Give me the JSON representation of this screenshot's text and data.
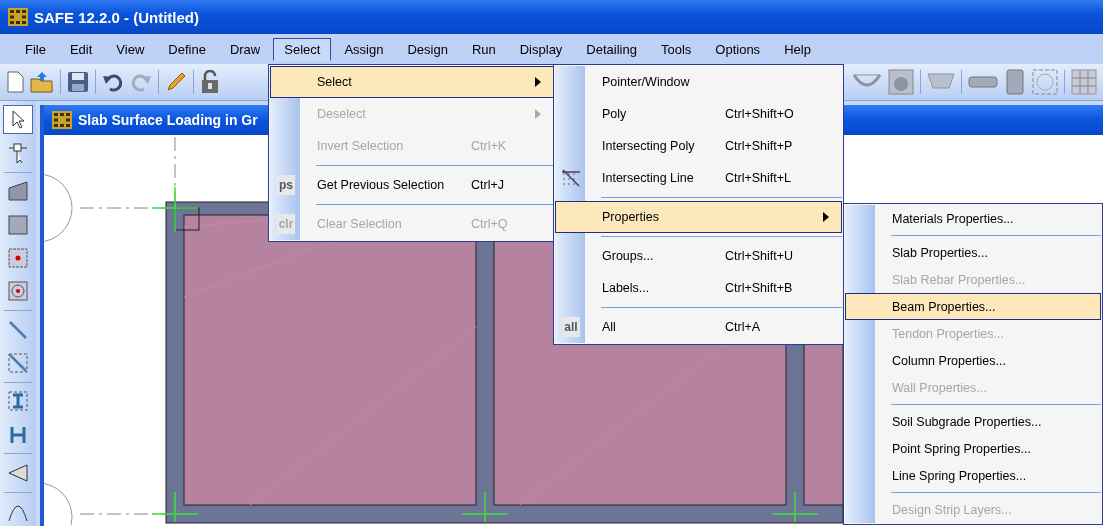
{
  "window": {
    "title": "SAFE 12.2.0 - (Untitled)"
  },
  "menu_bar": [
    {
      "label": "File",
      "selected": false
    },
    {
      "label": "Edit",
      "selected": false
    },
    {
      "label": "View",
      "selected": false
    },
    {
      "label": "Define",
      "selected": false
    },
    {
      "label": "Draw",
      "selected": false
    },
    {
      "label": "Select",
      "selected": true
    },
    {
      "label": "Assign",
      "selected": false
    },
    {
      "label": "Design",
      "selected": false
    },
    {
      "label": "Run",
      "selected": false
    },
    {
      "label": "Display",
      "selected": false
    },
    {
      "label": "Detailing",
      "selected": false
    },
    {
      "label": "Tools",
      "selected": false
    },
    {
      "label": "Options",
      "selected": false
    },
    {
      "label": "Help",
      "selected": false
    }
  ],
  "left_toolbar": [
    {
      "kind": "pointer",
      "selected": true
    },
    {
      "kind": "reshape",
      "selected": false
    },
    {
      "kind": "separator"
    },
    {
      "kind": "slab-poly",
      "selected": false
    },
    {
      "kind": "slab-rect",
      "selected": false
    },
    {
      "kind": "point",
      "selected": false
    },
    {
      "kind": "circle",
      "selected": false
    },
    {
      "kind": "separator"
    },
    {
      "kind": "line",
      "selected": false
    },
    {
      "kind": "line-box",
      "selected": false
    },
    {
      "kind": "separator"
    },
    {
      "kind": "beam",
      "selected": false
    },
    {
      "kind": "column",
      "selected": false
    },
    {
      "kind": "separator"
    },
    {
      "kind": "wedge",
      "selected": false
    },
    {
      "kind": "separator"
    },
    {
      "kind": "curve",
      "selected": false
    }
  ],
  "view_window": {
    "title": "Slab Surface Loading in Gr"
  },
  "select_menu": [
    {
      "kind": "item",
      "label": "Select",
      "submenu": true,
      "selected": true,
      "disabled": false
    },
    {
      "kind": "item",
      "label": "Deselect",
      "submenu": true,
      "selected": false,
      "disabled": true
    },
    {
      "kind": "item",
      "label": "Invert Selection",
      "shortcut": "Ctrl+K",
      "selected": false,
      "disabled": true
    },
    {
      "kind": "separator"
    },
    {
      "kind": "item",
      "label": "Get Previous Selection",
      "shortcut": "Ctrl+J",
      "badge": "ps",
      "selected": false,
      "disabled": false
    },
    {
      "kind": "separator"
    },
    {
      "kind": "item",
      "label": "Clear Selection",
      "shortcut": "Ctrl+Q",
      "badge": "clr",
      "selected": false,
      "disabled": true
    }
  ],
  "select_submenu": [
    {
      "kind": "item",
      "label": "Pointer/Window",
      "selected": false,
      "disabled": false
    },
    {
      "kind": "item",
      "label": "Poly",
      "shortcut": "Ctrl+Shift+O",
      "selected": false,
      "disabled": false
    },
    {
      "kind": "item",
      "label": "Intersecting Poly",
      "shortcut": "Ctrl+Shift+P",
      "selected": false,
      "disabled": false
    },
    {
      "kind": "icon-item",
      "label": "Intersecting Line",
      "shortcut": "Ctrl+Shift+L",
      "selected": false,
      "disabled": false
    },
    {
      "kind": "separator"
    },
    {
      "kind": "item",
      "label": "Properties",
      "submenu": true,
      "selected": true,
      "disabled": false
    },
    {
      "kind": "separator"
    },
    {
      "kind": "item",
      "label": "Groups...",
      "shortcut": "Ctrl+Shift+U",
      "selected": false,
      "disabled": false
    },
    {
      "kind": "item",
      "label": "Labels...",
      "shortcut": "Ctrl+Shift+B",
      "selected": false,
      "disabled": false
    },
    {
      "kind": "separator"
    },
    {
      "kind": "item",
      "label": "All",
      "shortcut": "Ctrl+A",
      "badge": "all",
      "selected": false,
      "disabled": false
    }
  ],
  "properties_submenu": [
    {
      "kind": "item",
      "label": "Materials Properties...",
      "selected": false,
      "disabled": false
    },
    {
      "kind": "separator"
    },
    {
      "kind": "item",
      "label": "Slab Properties...",
      "selected": false,
      "disabled": false
    },
    {
      "kind": "item",
      "label": "Slab Rebar Properties...",
      "selected": false,
      "disabled": true
    },
    {
      "kind": "item",
      "label": "Beam Properties...",
      "selected": true,
      "disabled": false
    },
    {
      "kind": "item",
      "label": "Tendon Properties...",
      "selected": false,
      "disabled": true
    },
    {
      "kind": "item",
      "label": "Column Properties...",
      "selected": false,
      "disabled": false
    },
    {
      "kind": "item",
      "label": "Wall Properties...",
      "selected": false,
      "disabled": true
    },
    {
      "kind": "separator"
    },
    {
      "kind": "item",
      "label": "Soil Subgrade Properties...",
      "selected": false,
      "disabled": false
    },
    {
      "kind": "item",
      "label": "Point Spring Properties...",
      "selected": false,
      "disabled": false
    },
    {
      "kind": "item",
      "label": "Line Spring Properties...",
      "selected": false,
      "disabled": false
    },
    {
      "kind": "separator"
    },
    {
      "kind": "item",
      "label": "Design Strip Layers...",
      "selected": false,
      "disabled": true
    }
  ]
}
